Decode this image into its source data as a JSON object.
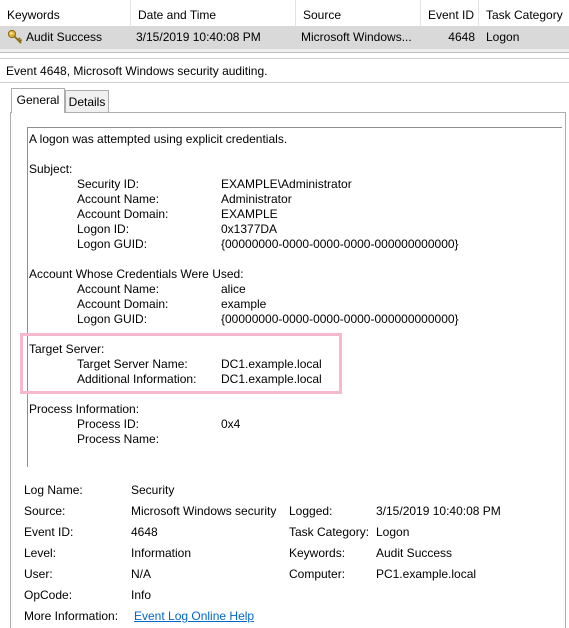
{
  "grid": {
    "headers": [
      "Keywords",
      "Date and Time",
      "Source",
      "Event ID",
      "Task Category"
    ],
    "row": {
      "keywords": "Audit Success",
      "datetime": "3/15/2019 10:40:08 PM",
      "source": "Microsoft Windows...",
      "event_id": "4648",
      "task_category": "Logon"
    }
  },
  "event_title": "Event 4648, Microsoft Windows security auditing.",
  "tabs": [
    "General",
    "Details"
  ],
  "message": {
    "intro": "A logon was attempted using explicit credentials.",
    "subject_header": "Subject:",
    "subject": [
      {
        "label": "Security ID:",
        "value": "EXAMPLE\\Administrator"
      },
      {
        "label": "Account Name:",
        "value": "Administrator"
      },
      {
        "label": "Account Domain:",
        "value": "EXAMPLE"
      },
      {
        "label": "Logon ID:",
        "value": "0x1377DA"
      },
      {
        "label": "Logon GUID:",
        "value": "{00000000-0000-0000-0000-000000000000}"
      }
    ],
    "account_header": "Account Whose Credentials Were Used:",
    "account": [
      {
        "label": "Account Name:",
        "value": "alice"
      },
      {
        "label": "Account Domain:",
        "value": "example"
      },
      {
        "label": "Logon GUID:",
        "value": "{00000000-0000-0000-0000-000000000000}"
      }
    ],
    "target_header": "Target Server:",
    "target": [
      {
        "label": "Target Server Name:",
        "value": "DC1.example.local"
      },
      {
        "label": "Additional Information:",
        "value": "DC1.example.local"
      }
    ],
    "process_header": "Process Information:",
    "process": [
      {
        "label": "Process ID:",
        "value": "0x4"
      },
      {
        "label": "Process Name:",
        "value": ""
      }
    ]
  },
  "properties": {
    "log_name_label": "Log Name:",
    "log_name": "Security",
    "source_label": "Source:",
    "source": "Microsoft Windows security",
    "logged_label": "Logged:",
    "logged": "3/15/2019 10:40:08 PM",
    "event_id_label": "Event ID:",
    "event_id": "4648",
    "task_category_label": "Task Category:",
    "task_category": "Logon",
    "level_label": "Level:",
    "level": "Information",
    "keywords_label": "Keywords:",
    "keywords": "Audit Success",
    "user_label": "User:",
    "user": "N/A",
    "computer_label": "Computer:",
    "computer": "PC1.example.local",
    "opcode_label": "OpCode:",
    "opcode": "Info",
    "more_info_label": "More Information:",
    "more_info_link": "Event Log Online Help"
  },
  "colors": {
    "highlight_box": "#f6b8cf",
    "selected_row": "#d9d9d9",
    "link": "#0066cc"
  }
}
